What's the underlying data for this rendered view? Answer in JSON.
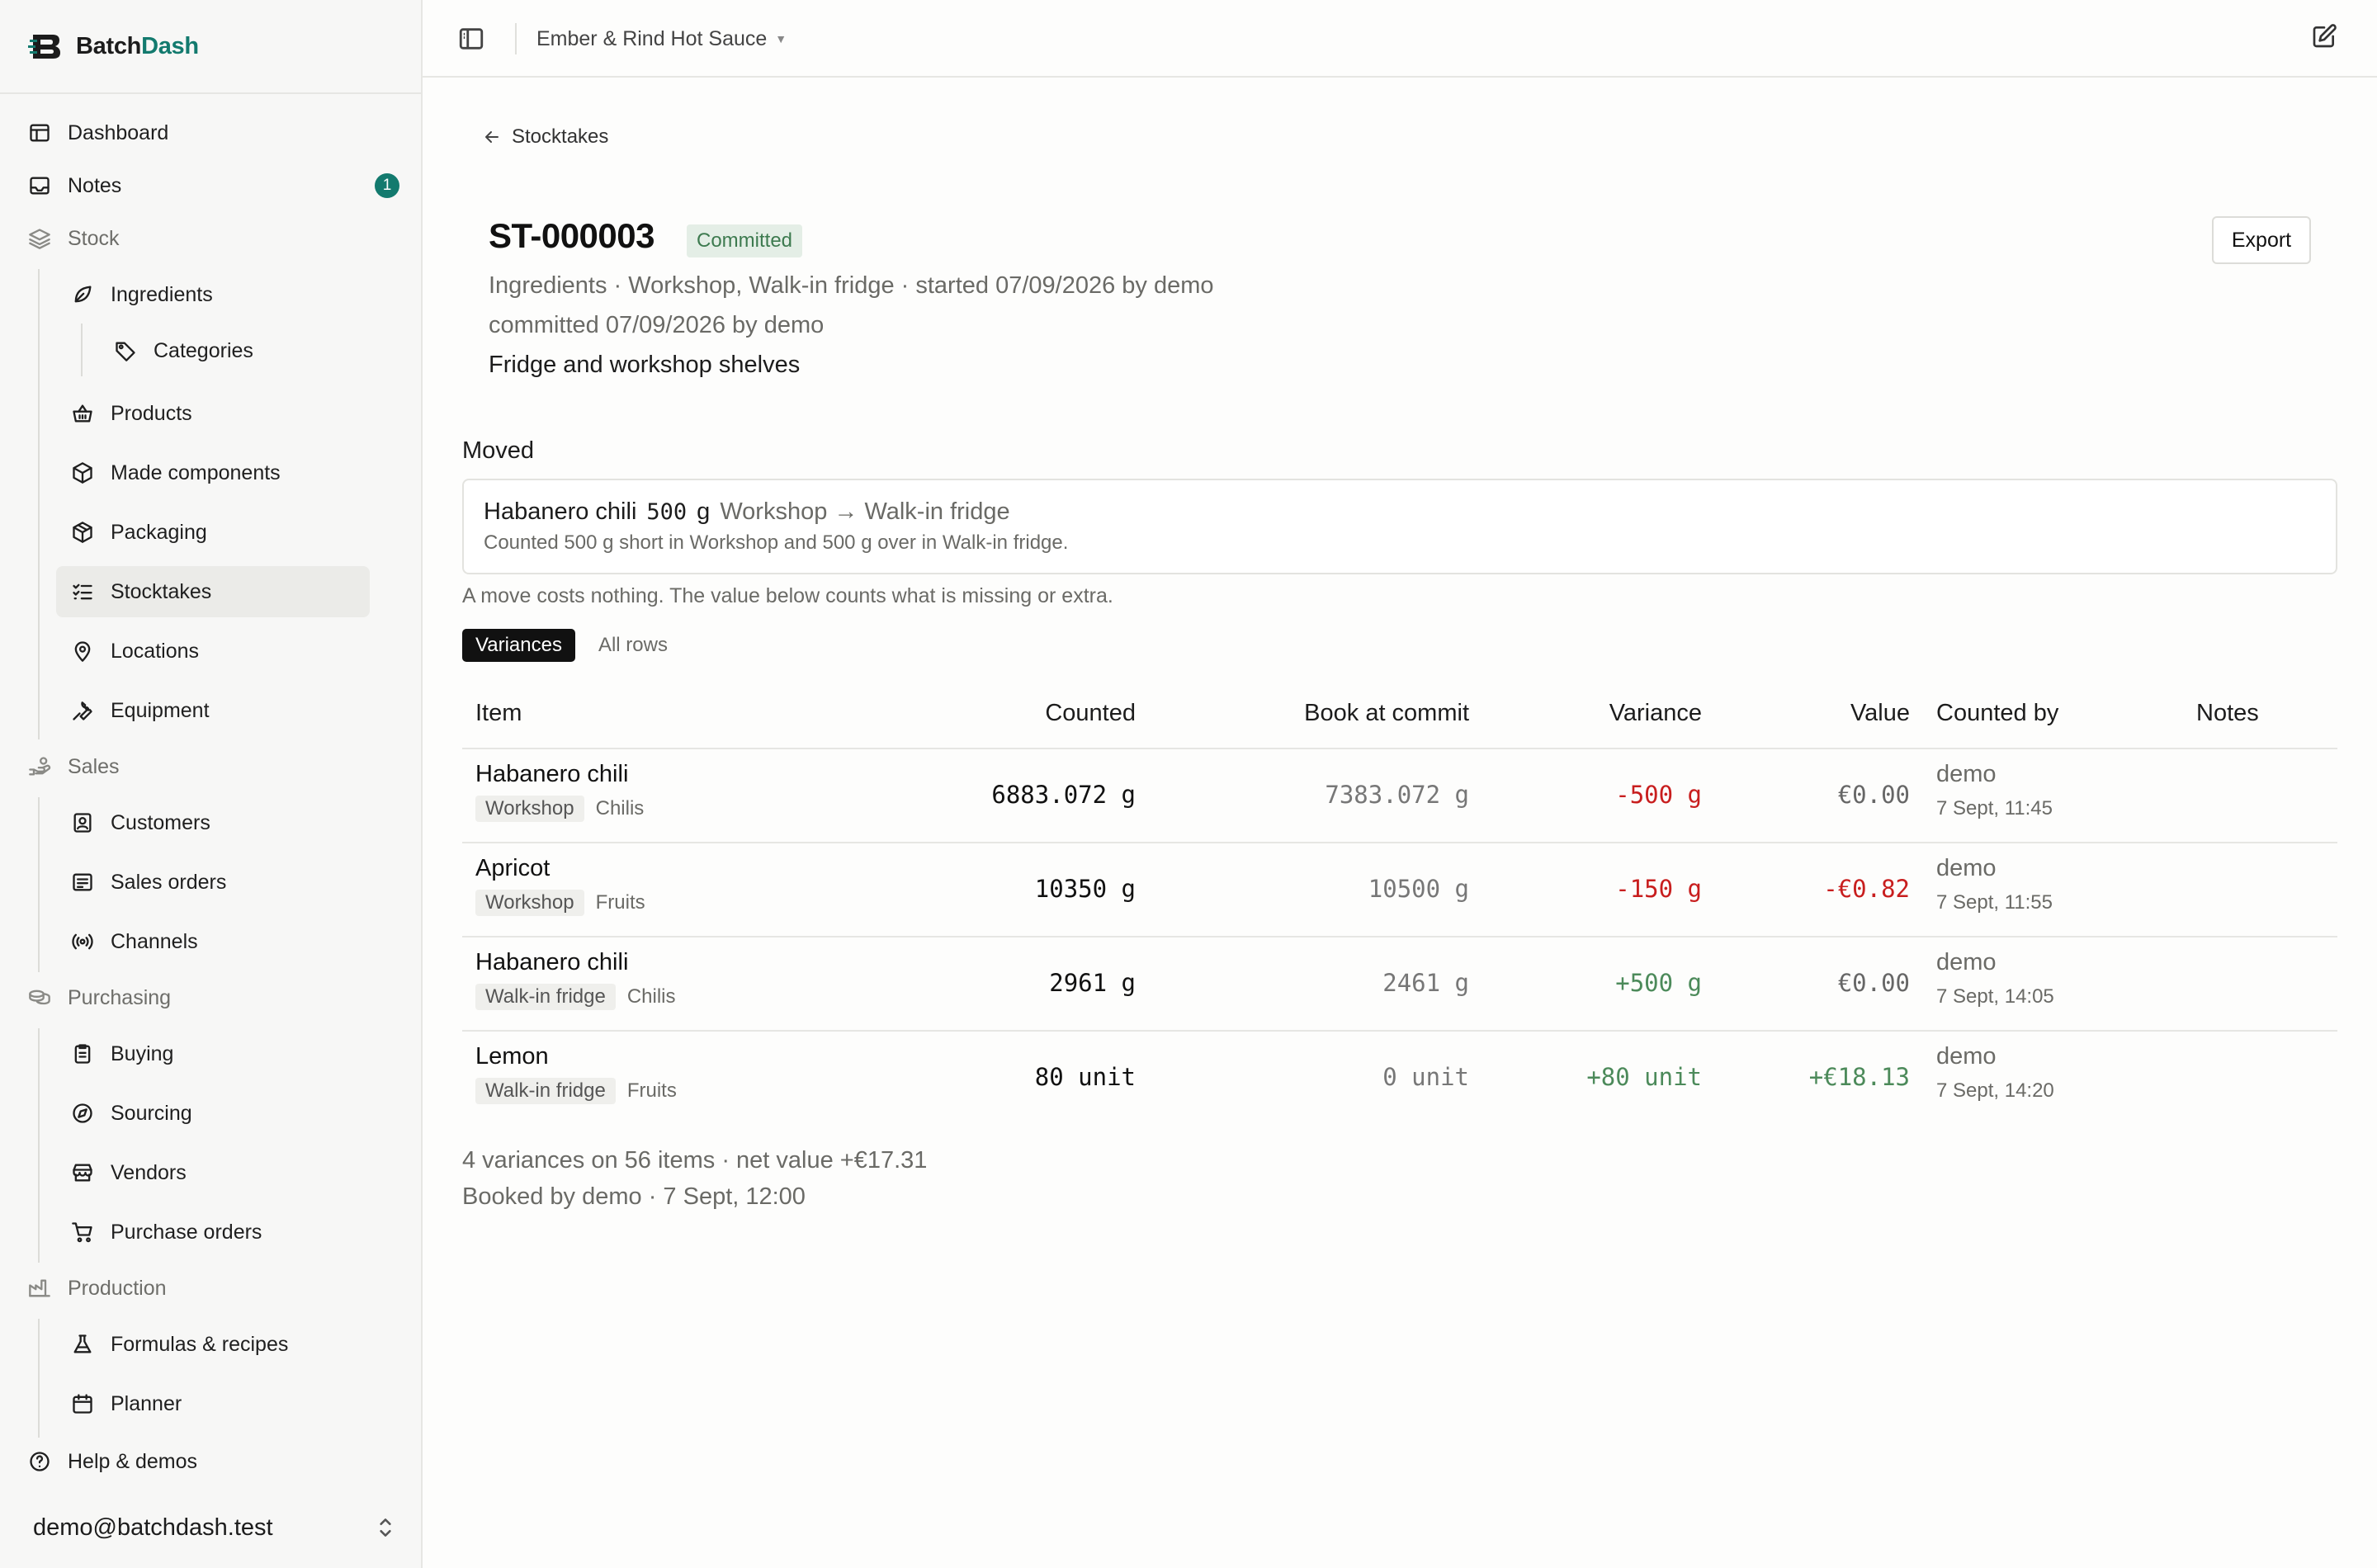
{
  "app": {
    "name_part1": "Batch",
    "name_part2": "Dash",
    "accent_color": "#137a6e"
  },
  "sidebar": {
    "dashboard": "Dashboard",
    "notes": "Notes",
    "notes_count": "1",
    "stock_group": "Stock",
    "ingredients": "Ingredients",
    "categories": "Categories",
    "products": "Products",
    "made_components": "Made components",
    "packaging": "Packaging",
    "stocktakes": "Stocktakes",
    "locations": "Locations",
    "equipment": "Equipment",
    "sales_group": "Sales",
    "customers": "Customers",
    "sales_orders": "Sales orders",
    "channels": "Channels",
    "purchasing_group": "Purchasing",
    "buying": "Buying",
    "sourcing": "Sourcing",
    "vendors": "Vendors",
    "purchase_orders": "Purchase orders",
    "production_group": "Production",
    "formulas": "Formulas & recipes",
    "planner": "Planner",
    "help": "Help & demos",
    "user_email": "demo@batchdash.test"
  },
  "topbar": {
    "workspace": "Ember & Rind Hot Sauce"
  },
  "page": {
    "back_label": "Stocktakes",
    "title": "ST-000003",
    "status": "Committed",
    "export_label": "Export",
    "meta_line1": "Ingredients · Workshop, Walk-in fridge · started 07/09/2026 by demo",
    "meta_line2": "committed 07/09/2026 by demo",
    "description": "Fridge and workshop shelves"
  },
  "moved": {
    "section_title": "Moved",
    "item": "Habanero chili",
    "qty": "500",
    "unit": "g",
    "route": "Workshop → Walk-in fridge",
    "detail": "Counted 500 g short in Workshop and 500 g over in Walk-in fridge.",
    "note": "A move costs nothing. The value below counts what is missing or extra."
  },
  "tabs": {
    "variances": "Variances",
    "all_rows": "All rows"
  },
  "table": {
    "headers": {
      "item": "Item",
      "counted": "Counted",
      "book": "Book at commit",
      "variance": "Variance",
      "value": "Value",
      "counted_by": "Counted by",
      "notes": "Notes"
    },
    "rows": [
      {
        "item": "Habanero chili",
        "location": "Workshop",
        "category": "Chilis",
        "counted": "6883.072 g",
        "book": "7383.072 g",
        "variance": "-500 g",
        "value": "€0.00",
        "counted_by": "demo",
        "when": "7 Sept, 11:45"
      },
      {
        "item": "Apricot",
        "location": "Workshop",
        "category": "Fruits",
        "counted": "10350 g",
        "book": "10500 g",
        "variance": "-150 g",
        "value": "-€0.82",
        "counted_by": "demo",
        "when": "7 Sept, 11:55"
      },
      {
        "item": "Habanero chili",
        "location": "Walk-in fridge",
        "category": "Chilis",
        "counted": "2961 g",
        "book": "2461 g",
        "variance": "+500 g",
        "value": "€0.00",
        "counted_by": "demo",
        "when": "7 Sept, 14:05"
      },
      {
        "item": "Lemon",
        "location": "Walk-in fridge",
        "category": "Fruits",
        "counted": "80 unit",
        "book": "0 unit",
        "variance": "+80 unit",
        "value": "+€18.13",
        "counted_by": "demo",
        "when": "7 Sept, 14:20"
      }
    ]
  },
  "summary": {
    "line1": "4 variances on 56 items · net value +€17.31",
    "line2": "Booked by demo · 7 Sept, 12:00"
  },
  "colors": {
    "negative": "#c81e1e",
    "positive": "#4c8a5a",
    "badge_bg": "#e4eee6",
    "badge_text": "#3d7a4f"
  }
}
